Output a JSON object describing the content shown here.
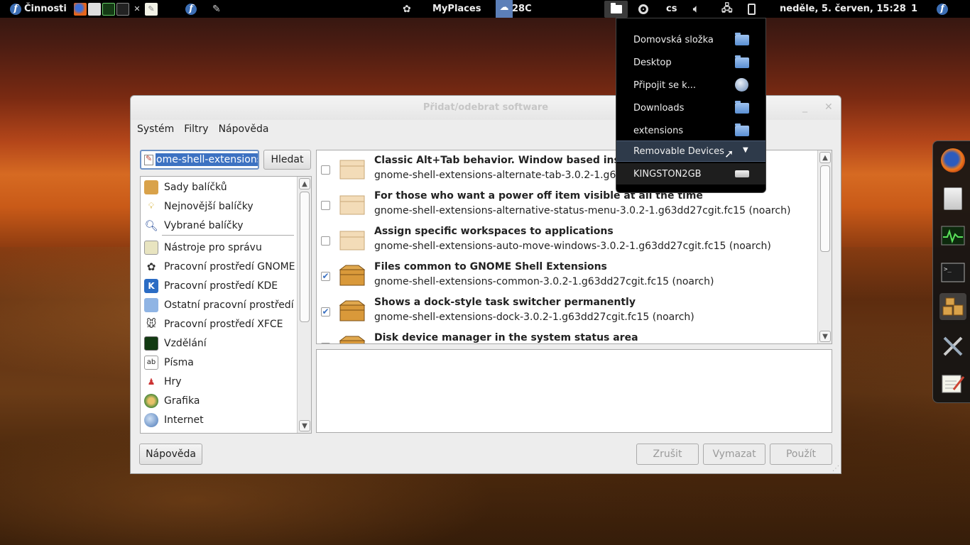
{
  "top_panel": {
    "activities_label": "Činnosti",
    "myplaces_label": "MyPlaces",
    "weather_label": "28C",
    "keyboard_layout": "cs",
    "clock": "neděle,  5. červen, 15:28",
    "workspace_number": "1"
  },
  "window": {
    "title": "Přidat/odebrat software",
    "menu": [
      "Systém",
      "Filtry",
      "Nápověda"
    ],
    "search": {
      "value": "ome-shell-extensions",
      "button_label": "Hledat"
    },
    "groups": [
      {
        "label": "Sady balíčků",
        "icon": "package-collection-icon"
      },
      {
        "label": "Nejnovější balíčky",
        "icon": "lightbulb-icon"
      },
      {
        "label": "Vybrané balíčky",
        "icon": "magnifier-icon"
      },
      {
        "label": "Nástroje pro správu",
        "icon": "admin-tools-icon"
      },
      {
        "label": "Pracovní prostředí GNOME",
        "icon": "gnome-foot-icon"
      },
      {
        "label": "Pracovní prostředí KDE",
        "icon": "kde-icon"
      },
      {
        "label": "Ostatní pracovní prostředí",
        "icon": "desktop-icon"
      },
      {
        "label": "Pracovní prostředí XFCE",
        "icon": "xfce-mouse-icon"
      },
      {
        "label": "Vzdělání",
        "icon": "education-monitor-icon"
      },
      {
        "label": "Písma",
        "icon": "fonts-icon"
      },
      {
        "label": "Hry",
        "icon": "games-icon"
      },
      {
        "label": "Grafika",
        "icon": "graphics-palette-icon"
      },
      {
        "label": "Internet",
        "icon": "internet-globe-icon"
      }
    ],
    "packages": [
      {
        "summary": "Classic Alt+Tab behavior. Window based instead of app based",
        "name": "gnome-shell-extensions-alternate-tab-3.0.2-1.g63dd27cgit.fc15 (noarch)",
        "checked": false,
        "installed": false
      },
      {
        "summary": "For those who want a power off item visible at all the time",
        "name": "gnome-shell-extensions-alternative-status-menu-3.0.2-1.g63dd27cgit.fc15 (noarch)",
        "checked": false,
        "installed": false
      },
      {
        "summary": "Assign specific workspaces to applications",
        "name": "gnome-shell-extensions-auto-move-windows-3.0.2-1.g63dd27cgit.fc15 (noarch)",
        "checked": false,
        "installed": false
      },
      {
        "summary": "Files common to GNOME Shell Extensions",
        "name": "gnome-shell-extensions-common-3.0.2-1.g63dd27cgit.fc15 (noarch)",
        "checked": true,
        "installed": true
      },
      {
        "summary": "Shows a dock-style task switcher permanently",
        "name": "gnome-shell-extensions-dock-3.0.2-1.g63dd27cgit.fc15 (noarch)",
        "checked": true,
        "installed": true
      },
      {
        "summary": "Disk device manager in the system status area",
        "name": "",
        "checked": false,
        "installed": true
      }
    ],
    "buttons": {
      "help": "Nápověda",
      "cancel": "Zrušit",
      "clear": "Vymazat",
      "apply": "Použít"
    }
  },
  "places_menu": {
    "items": [
      {
        "label": "Domovská složka",
        "icon": "home-folder-icon"
      },
      {
        "label": "Desktop",
        "icon": "desktop-folder-icon"
      },
      {
        "label": "Připojit se k...",
        "icon": "network-globe-icon"
      },
      {
        "label": "Downloads",
        "icon": "downloads-folder-icon"
      },
      {
        "label": "extensions",
        "icon": "folder-icon"
      }
    ],
    "removable_label": "Removable Devices",
    "device_label": "KINGSTON2GB"
  },
  "colors": {
    "selection": "#3d72c2",
    "menu_bg": "#000000",
    "panel_bg": "#000000"
  }
}
